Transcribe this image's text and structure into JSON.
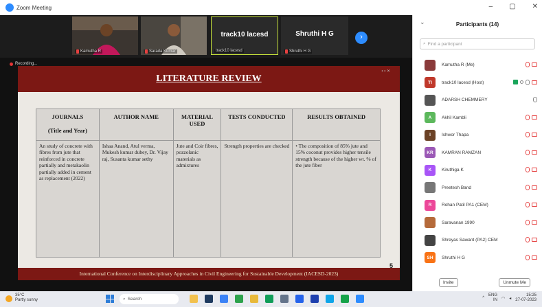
{
  "window": {
    "title": "Zoom Meeting",
    "controls": [
      "–",
      "▢",
      "✕"
    ]
  },
  "video_strip": {
    "tiles": [
      {
        "name": "Kamutha R",
        "muted": true
      },
      {
        "name": "Sarada Kumar",
        "muted": true
      },
      {
        "name": "track10 lacesd",
        "label": "track10 lacesd",
        "muted": false
      },
      {
        "name": "Shruthi H G",
        "label": "Shruthi H G",
        "muted": true
      }
    ],
    "next_glyph": "›"
  },
  "share": {
    "recording_label": "Recording..."
  },
  "slide": {
    "title": "LITERATURE REVIEW",
    "headers": {
      "journals": "JOURNALS",
      "journals_sub": "(Title and Year)",
      "author": "AUTHOR NAME",
      "material": "MATERIAL USED",
      "tests": "TESTS CONDUCTED",
      "results": "RESULTS OBTAINED"
    },
    "row": {
      "journals": "An study of concrete with fibres from jute that reinforced in concrete partially and metakaolin partially added in cement as replacement (2022)",
      "author": "Ishaa Anand, Atul verma, Mukesh kumar dubey, Dr. Vijay raj, Susanta kumar sethy",
      "material": "Jute and Coir fibres, pozzolanic materials as admixtures",
      "tests": "Strength properties are checked",
      "results": "The composition of 85% jute and 15% coconut provides higher tensile strength because of the higher wt. % of the jute fiber"
    },
    "page_number": "5",
    "footer": "International Conference on Interdisciplinary Approaches in Civil Engineering for Sustainable Development (IACESD-2023)"
  },
  "participants": {
    "title": "Participants (14)",
    "search_placeholder": "Find a participant",
    "items": [
      {
        "initials": "",
        "color": "#8a3a3a",
        "name": "Kamutha R (Me)",
        "host": false,
        "mic_on": false
      },
      {
        "initials": "TI",
        "color": "#c0392b",
        "name": "track10 lacesd (Host)",
        "host": true,
        "mic_on": true
      },
      {
        "initials": "",
        "color": "#555555",
        "name": "ADARSH CHEMMERY",
        "host": false,
        "mic_on": true
      },
      {
        "initials": "A",
        "color": "#5cb85c",
        "name": "Akhil Kambli",
        "host": false,
        "mic_on": false
      },
      {
        "initials": "I",
        "color": "#6b4226",
        "name": "Ishwor Thapa",
        "host": false,
        "mic_on": false
      },
      {
        "initials": "KR",
        "color": "#9b59b6",
        "name": "KAMRAN RAMZAN",
        "host": false,
        "mic_on": false
      },
      {
        "initials": "K",
        "color": "#a855f7",
        "name": "Kiruthiga K",
        "host": false,
        "mic_on": false
      },
      {
        "initials": "",
        "color": "#777777",
        "name": "Preetesh Band",
        "host": false,
        "mic_on": false
      },
      {
        "initials": "R",
        "color": "#ec4899",
        "name": "Rohan Patil PA1 (CEM)",
        "host": false,
        "mic_on": false
      },
      {
        "initials": "",
        "color": "#b56a3a",
        "name": "Saravanan 1990",
        "host": false,
        "mic_on": false
      },
      {
        "initials": "",
        "color": "#444444",
        "name": "Shreyas Sawant (PA2) CEM",
        "host": false,
        "mic_on": false
      },
      {
        "initials": "SH",
        "color": "#f97316",
        "name": "Shruthi H G",
        "host": false,
        "mic_on": false
      }
    ],
    "invite_label": "Invite",
    "unmute_label": "Unmute Me"
  },
  "taskbar": {
    "temperature": "35°C",
    "weather": "Partly sunny",
    "search_label": "Search",
    "language": "ENG",
    "region": "IN",
    "time": "15:25",
    "date": "27-07-2023"
  }
}
